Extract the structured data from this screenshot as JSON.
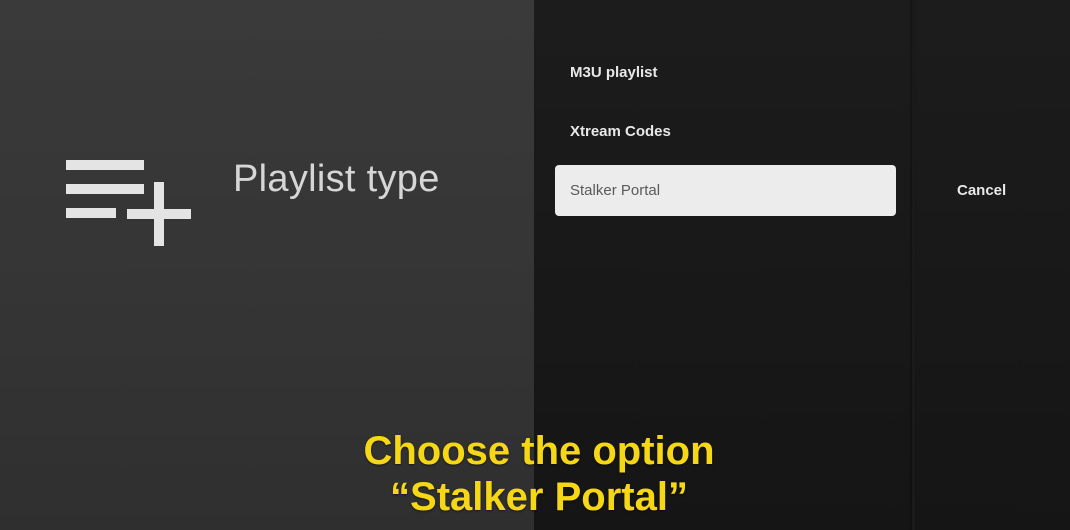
{
  "dialog": {
    "title": "Playlist type",
    "icon": "playlist-add-icon"
  },
  "options": [
    {
      "label": "M3U playlist",
      "selected": false
    },
    {
      "label": "Xtream Codes",
      "selected": false
    },
    {
      "label": "Stalker Portal",
      "selected": true
    }
  ],
  "cancel_label": "Cancel",
  "caption": {
    "line1": "Choose the option",
    "line2": "“Stalker Portal”"
  },
  "colors": {
    "caption": "#f5d716",
    "selected_bg": "#ececec"
  }
}
